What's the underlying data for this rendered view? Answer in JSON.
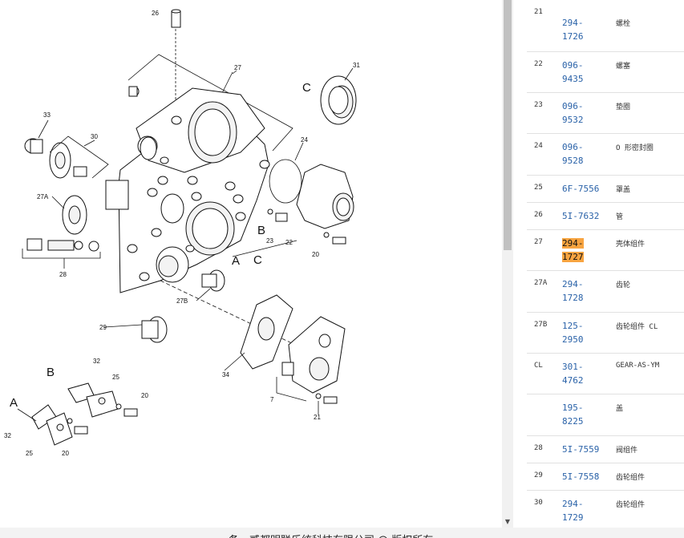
{
  "diagram": {
    "labels": {
      "l26": "26",
      "l27": "27",
      "l31": "31",
      "lC1": "C",
      "l33": "33",
      "l30": "30",
      "l24": "24",
      "l27A": "27A",
      "lB1": "B",
      "l23": "23",
      "l22": "22",
      "l20a": "20",
      "l28": "28",
      "lA1": "A",
      "lC2": "C",
      "l27B": "27B",
      "l29": "29",
      "l32a": "32",
      "lB2": "B",
      "l25a": "25",
      "l20b": "20",
      "lA2": "A",
      "l34": "34",
      "l7": "7",
      "l21": "21",
      "l32b": "32",
      "l25b": "25",
      "l20c": "20"
    }
  },
  "parts": {
    "rows": [
      {
        "num": "21",
        "pn": "294-\n1726",
        "desc": "螺栓"
      },
      {
        "num": "22",
        "pn": "096-\n9435",
        "desc": "螺塞"
      },
      {
        "num": "23",
        "pn": "096-\n9532",
        "desc": "垫圈"
      },
      {
        "num": "24",
        "pn": "096-\n9528",
        "desc": "O 形密封圈"
      },
      {
        "num": "25",
        "pn": "6F-7556",
        "desc": "罩盖"
      },
      {
        "num": "26",
        "pn": "5I-7632",
        "desc": "管"
      },
      {
        "num": "27",
        "pn_line1": "294-",
        "pn_line2": "1727",
        "desc": "壳体组件",
        "highlighted": true
      },
      {
        "num": "27A",
        "pn": "294-\n1728",
        "desc": "齿轮"
      },
      {
        "num": "27B",
        "pn": "125-\n2950",
        "desc": "齿轮组件 CL"
      },
      {
        "num": "CL",
        "pn": "301-\n4762",
        "desc": "GEAR-AS-YM"
      },
      {
        "num": "",
        "pn": "195-\n8225",
        "desc": "盖"
      },
      {
        "num": "28",
        "pn": "5I-7559",
        "desc": "阀组件"
      },
      {
        "num": "29",
        "pn": "5I-7558",
        "desc": "齿轮组件"
      },
      {
        "num": "30",
        "pn": "294-\n1729",
        "desc": "齿轮组件"
      }
    ]
  },
  "colors": {
    "link": "#2a62a8",
    "highlight": "#f8a440"
  },
  "footer": {
    "text": "备一贰都明联乐统科技有限公司 @ 版权所有"
  },
  "scrollbar": {
    "down_arrow": "▼"
  }
}
